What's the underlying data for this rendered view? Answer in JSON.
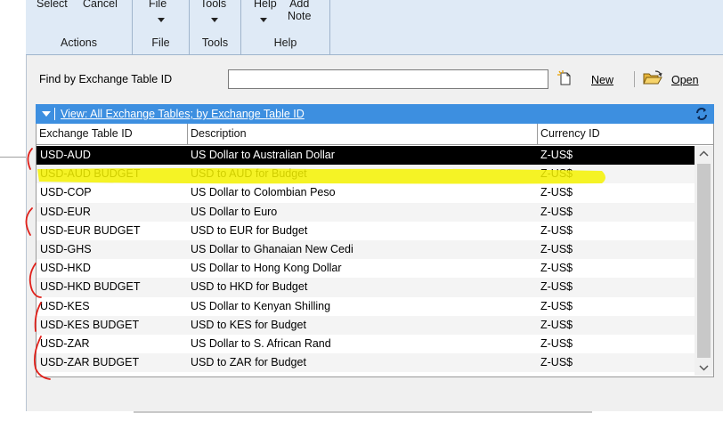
{
  "ribbon": {
    "actions": {
      "select": "Select",
      "cancel": "Cancel",
      "label": "Actions"
    },
    "file": {
      "button": "File",
      "label": "File"
    },
    "tools": {
      "button": "Tools",
      "label": "Tools"
    },
    "help": {
      "button": "Help",
      "add_note_line1": "Add",
      "add_note_line2": "Note",
      "label": "Help"
    }
  },
  "find": {
    "label": "Find by Exchange Table ID",
    "value": "",
    "new_label": "New",
    "open_label": "Open"
  },
  "view": {
    "text": "View: All Exchange Tables; by Exchange Table ID"
  },
  "grid": {
    "headers": [
      "Exchange Table ID",
      "Description",
      "Currency ID"
    ],
    "rows": [
      {
        "id": "USD-AUD",
        "desc": "US Dollar to Australian Dollar",
        "cur": "Z-US$"
      },
      {
        "id": "USD-AUD BUDGET",
        "desc": "USD to AUD for Budget",
        "cur": "Z-US$"
      },
      {
        "id": "USD-COP",
        "desc": "US Dollar to Colombian Peso",
        "cur": "Z-US$"
      },
      {
        "id": "USD-EUR",
        "desc": "US Dollar to Euro",
        "cur": "Z-US$"
      },
      {
        "id": "USD-EUR BUDGET",
        "desc": "USD to EUR for Budget",
        "cur": "Z-US$"
      },
      {
        "id": "USD-GHS",
        "desc": "US Dollar to Ghanaian New Cedi",
        "cur": "Z-US$"
      },
      {
        "id": "USD-HKD",
        "desc": "US Dollar to Hong Kong Dollar",
        "cur": "Z-US$"
      },
      {
        "id": "USD-HKD BUDGET",
        "desc": "USD to HKD for Budget",
        "cur": "Z-US$"
      },
      {
        "id": "USD-KES",
        "desc": "US Dollar to Kenyan Shilling",
        "cur": "Z-US$"
      },
      {
        "id": "USD-KES BUDGET",
        "desc": "USD to KES for Budget",
        "cur": "Z-US$"
      },
      {
        "id": "USD-ZAR",
        "desc": "US Dollar to S. African Rand",
        "cur": "Z-US$"
      },
      {
        "id": "USD-ZAR BUDGET",
        "desc": "USD to ZAR for Budget",
        "cur": "Z-US$"
      }
    ],
    "selected_row": 0
  },
  "colors": {
    "ribbon_bg": "#dfeaf6",
    "view_bar": "#3d8fe0",
    "selection": "#000000",
    "highlighter": "#f5f200",
    "annotation_pen": "#e0201a"
  },
  "icons": [
    "new-document-icon",
    "open-folder-icon",
    "refresh-icon",
    "dropdown-caret-icon"
  ]
}
